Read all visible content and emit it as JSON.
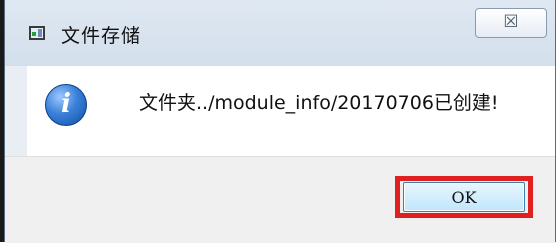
{
  "window": {
    "title": "文件存储",
    "app_icon": "window-app-icon",
    "close_symbol": "☒"
  },
  "message": {
    "icon": "info-icon",
    "icon_glyph": "i",
    "text": "文件夹../module_info/20170706已创建!"
  },
  "footer": {
    "ok_label": "OK",
    "highlight_color": "#e0201f"
  }
}
